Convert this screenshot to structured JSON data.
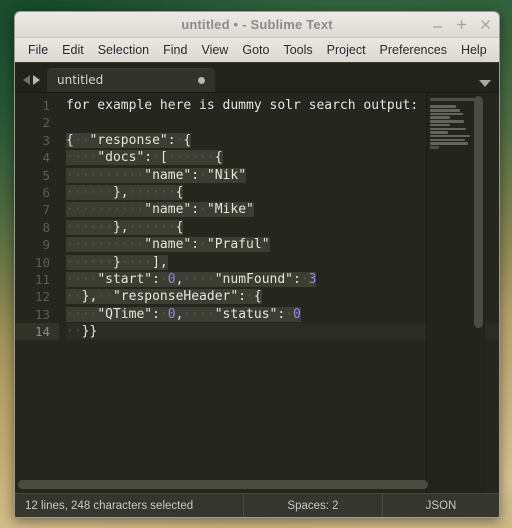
{
  "window": {
    "title": "untitled • - Sublime Text",
    "controls": [
      {
        "name": "minimize",
        "glyph": "minimize"
      },
      {
        "name": "maximize",
        "glyph": "maximize"
      },
      {
        "name": "close",
        "glyph": "close"
      }
    ]
  },
  "menubar": {
    "items": [
      {
        "label": "File"
      },
      {
        "label": "Edit"
      },
      {
        "label": "Selection"
      },
      {
        "label": "Find"
      },
      {
        "label": "View"
      },
      {
        "label": "Goto"
      },
      {
        "label": "Tools"
      },
      {
        "label": "Project"
      },
      {
        "label": "Preferences"
      },
      {
        "label": "Help"
      }
    ]
  },
  "tabbar": {
    "prev_icon": "arrow-left-icon",
    "next_icon": "arrow-right-icon",
    "menu_icon": "chevron-down-icon",
    "tabs": [
      {
        "label": "untitled",
        "modified": true,
        "active": true
      }
    ]
  },
  "editor": {
    "line_count": 14,
    "active_line": 14,
    "line_numbers": [
      "1",
      "2",
      "3",
      "4",
      "5",
      "6",
      "7",
      "8",
      "9",
      "10",
      "11",
      "12",
      "13",
      "14"
    ],
    "lines": [
      {
        "n": 1,
        "text": "for example here is dummy solr search output:",
        "selected": false
      },
      {
        "n": 2,
        "text": "",
        "selected": false
      },
      {
        "n": 3,
        "text": "{  \"response\": {",
        "selected": true
      },
      {
        "n": 4,
        "text": "    \"docs\": [      {",
        "selected": true
      },
      {
        "n": 5,
        "text": "          \"name\": \"Nik\"",
        "selected": true
      },
      {
        "n": 6,
        "text": "      },      {",
        "selected": true
      },
      {
        "n": 7,
        "text": "          \"name\": \"Mike\"",
        "selected": true
      },
      {
        "n": 8,
        "text": "      },      {",
        "selected": true
      },
      {
        "n": 9,
        "text": "          \"name\": \"Praful\"",
        "selected": true
      },
      {
        "n": 10,
        "text": "      }    ],",
        "selected": true
      },
      {
        "n": 11,
        "text": "    \"start\": 0,    \"numFound\": 3",
        "selected": true
      },
      {
        "n": 12,
        "text": "  },  \"responseHeader\": {",
        "selected": true
      },
      {
        "n": 13,
        "text": "    \"QTime\": 0,    \"status\": 0",
        "selected": true
      },
      {
        "n": 14,
        "text": "  }}",
        "selected": false
      }
    ],
    "colors": {
      "background": "#25261e",
      "foreground": "#e4e6d8",
      "selection": "#3c3e33",
      "number_token": "#9a86e0",
      "whitespace_marker": "#55574a",
      "gutter_number": "#5c5e4f",
      "active_line": "#2b2c23"
    }
  },
  "statusbar": {
    "selection_info": "12 lines, 248 characters selected",
    "indentation": "Spaces: 2",
    "syntax": "JSON"
  }
}
